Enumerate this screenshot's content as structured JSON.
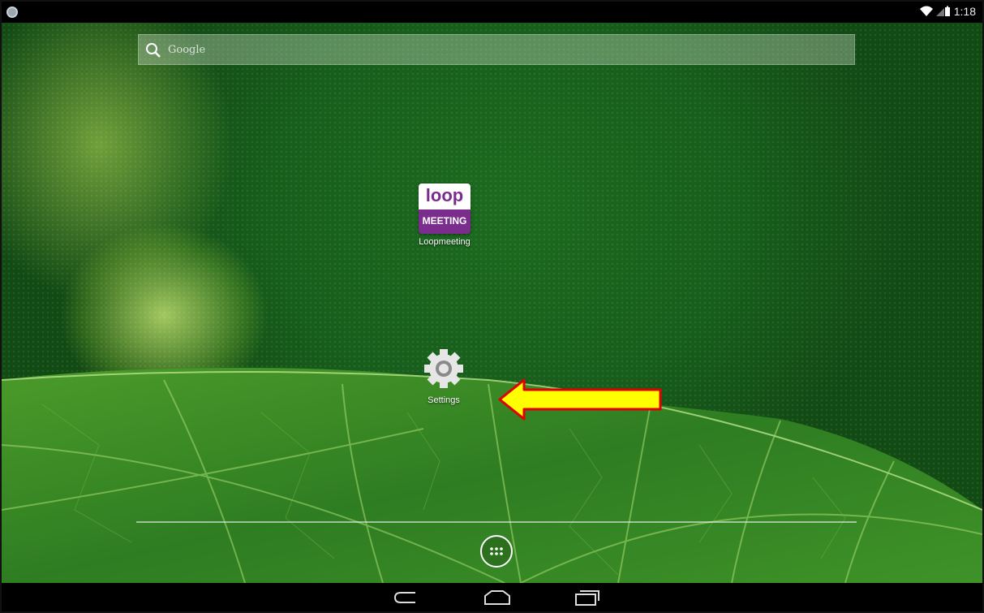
{
  "status_bar": {
    "clock": "1:18",
    "icons": [
      "debug-shield-icon",
      "wifi-icon",
      "battery-icon"
    ]
  },
  "search": {
    "label": "Google",
    "icon": "search-icon"
  },
  "apps": [
    {
      "label": "Loopmeeting",
      "icon": "loopmeeting-icon",
      "logo_top": "loop",
      "logo_bottom": "MEETING"
    },
    {
      "label": "Settings",
      "icon": "gear-icon"
    }
  ],
  "dock": {
    "icon": "all-apps-icon"
  },
  "nav_bar": {
    "buttons": [
      "back-icon",
      "home-icon",
      "recents-icon"
    ]
  },
  "annotation": {
    "icon": "arrow-icon",
    "color": "#ffff00",
    "outline": "#e00000"
  },
  "colors": {
    "loop_purple": "#7b2d8e",
    "wallpaper_green": "#1a6a1e"
  }
}
